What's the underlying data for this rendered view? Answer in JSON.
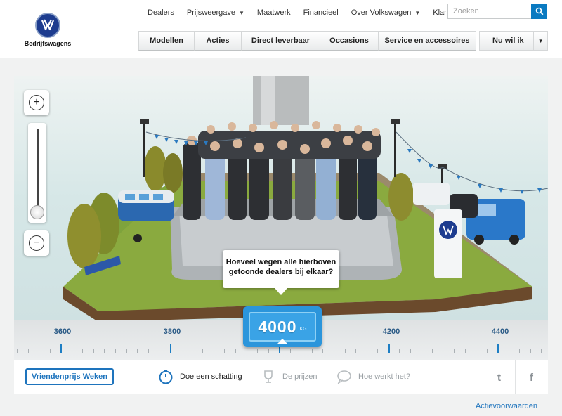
{
  "brand": {
    "name": "Bedrijfswagens",
    "logo_color": "#1d3c8f"
  },
  "topnav": {
    "items": [
      {
        "label": "Dealers",
        "dropdown": false
      },
      {
        "label": "Prijsweergave",
        "dropdown": true
      },
      {
        "label": "Maatwerk",
        "dropdown": false
      },
      {
        "label": "Financieel",
        "dropdown": false
      },
      {
        "label": "Over Volkswagen",
        "dropdown": true
      },
      {
        "label": "Klantenservice",
        "dropdown": false
      }
    ]
  },
  "search": {
    "placeholder": "Zoeken",
    "icon": "search-icon"
  },
  "mainnav": {
    "items": [
      "Modellen",
      "Acties",
      "Direct leverbaar",
      "Occasions",
      "Service en accessoires"
    ],
    "menu": "Nu wil ik"
  },
  "scene": {
    "question": "Hoeveel wegen alle hierboven getoonde dealers bij elkaar?",
    "zoom_in_icon": "plus-icon",
    "zoom_out_icon": "minus-icon",
    "zoom_level": 0.1
  },
  "scale": {
    "labels": [
      "3600",
      "3800",
      "4200",
      "4400"
    ],
    "current_value": "4000",
    "unit": "KG",
    "accent_color": "#2b95db"
  },
  "tabs": {
    "promo": "Vriendenprijs Weken",
    "items": [
      {
        "label": "Doe een schatting",
        "icon": "stopwatch-icon",
        "active": true
      },
      {
        "label": "De prijzen",
        "icon": "trophy-icon",
        "active": false
      },
      {
        "label": "Hoe werkt het?",
        "icon": "speech-bubble-icon",
        "active": false
      }
    ],
    "twitter_icon": "twitter-icon",
    "facebook_icon": "facebook-icon"
  },
  "footer": {
    "link": "Actievoorwaarden"
  },
  "colors": {
    "link_blue": "#1e74bd",
    "scale_blue": "#1d7ec4"
  }
}
